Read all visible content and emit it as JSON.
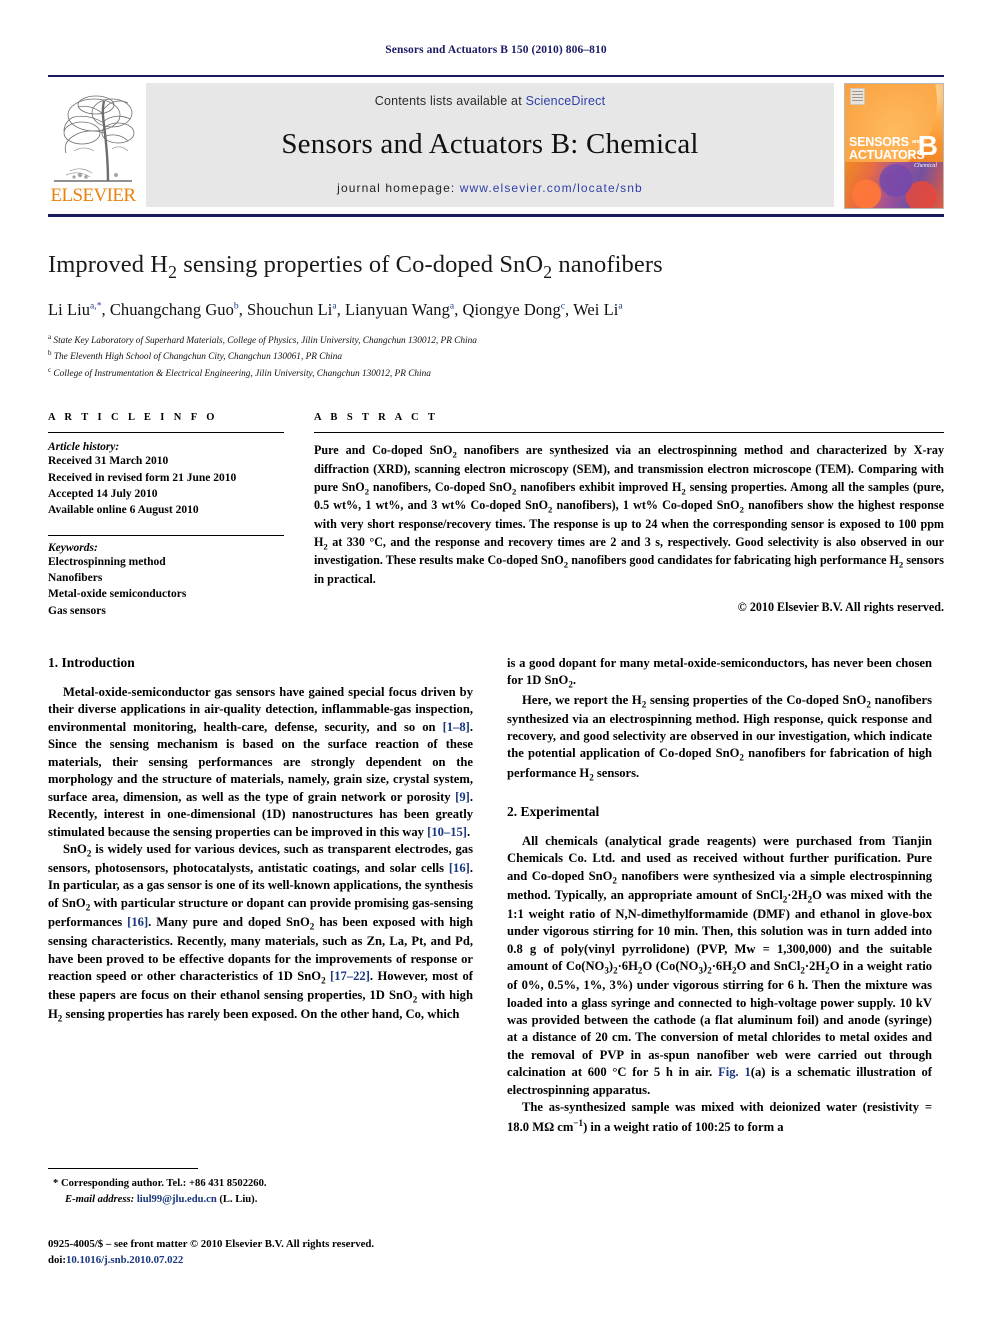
{
  "running_head": "Sensors and Actuators B 150 (2010) 806–810",
  "masthead": {
    "contents_text": "Contents lists available at",
    "sciencedirect_link": "ScienceDirect",
    "journal_title": "Sensors and Actuators B: Chemical",
    "homepage_label": "journal homepage:",
    "homepage_url": "www.elsevier.com/locate/snb",
    "publisher_wordmark": "ELSEVIER",
    "publisher_color": "#e8820c",
    "link_color": "#2f3fa8",
    "rule_color": "#1a1a5e",
    "cover": {
      "line1": "SENSORS",
      "and": "and",
      "line2": "ACTUATORS",
      "letter": "B",
      "subtitle": "Chemical"
    }
  },
  "title_block": {
    "title": "Improved H₂ sensing properties of Co-doped SnO₂ nanofibers",
    "authors": "Li Liu a,*, Chuangchang Guo b, Shouchun Li a, Lianyuan Wang a, Qiongye Dong c, Wei Li a",
    "affiliations": [
      "a State Key Laboratory of Superhard Materials, College of Physics, Jilin University, Changchun 130012, PR China",
      "b The Eleventh High School of Changchun City, Changchun 130061, PR China",
      "c College of Instrumentation & Electrical Engineering, Jilin University, Changchun 130012, PR China"
    ]
  },
  "article_info": {
    "heading": "A R T I C L E   I N F O",
    "history_label": "Article history:",
    "history": [
      "Received 31 March 2010",
      "Received in revised form 21 June 2010",
      "Accepted 14 July 2010",
      "Available online 6 August 2010"
    ],
    "keywords_label": "Keywords:",
    "keywords": [
      "Electrospinning method",
      "Nanofibers",
      "Metal-oxide semiconductors",
      "Gas sensors"
    ]
  },
  "abstract": {
    "heading": "A B S T R A C T",
    "text": "Pure and Co-doped SnO₂ nanofibers are synthesized via an electrospinning method and characterized by X-ray diffraction (XRD), scanning electron microscopy (SEM), and transmission electron microscope (TEM). Comparing with pure SnO₂ nanofibers, Co-doped SnO₂ nanofibers exhibit improved H₂ sensing properties. Among all the samples (pure, 0.5 wt%, 1 wt%, and 3 wt% Co-doped SnO₂ nanofibers), 1 wt% Co-doped SnO₂ nanofibers show the highest response with very short response/recovery times. The response is up to 24 when the corresponding sensor is exposed to 100 ppm H₂ at 330 °C, and the response and recovery times are 2 and 3 s, respectively. Good selectivity is also observed in our investigation. These results make Co-doped SnO₂ nanofibers good candidates for fabricating high performance H₂ sensors in practical.",
    "copyright": "© 2010 Elsevier B.V. All rights reserved."
  },
  "body": {
    "left": {
      "section_title": "1.  Introduction",
      "paragraphs": [
        "Metal-oxide-semiconductor gas sensors have gained special focus driven by their diverse applications in air-quality detection, inflammable-gas inspection, environmental monitoring, health-care, defense, security, and so on [1–8]. Since the sensing mechanism is based on the surface reaction of these materials, their sensing performances are strongly dependent on the morphology and the structure of materials, namely, grain size, crystal system, surface area, dimension, as well as the type of grain network or porosity [9]. Recently, interest in one-dimensional (1D) nanostructures has been greatly stimulated because the sensing properties can be improved in this way [10–15].",
        "SnO₂ is widely used for various devices, such as transparent electrodes, gas sensors, photosensors, photocatalysts, antistatic coatings, and solar cells [16]. In particular, as a gas sensor is one of its well-known applications, the synthesis of SnO₂ with particular structure or dopant can provide promising gas-sensing performances [16]. Many pure and doped SnO₂ has been exposed with high sensing characteristics. Recently, many materials, such as Zn, La, Pt, and Pd, have been proved to be effective dopants for the improvements of response or reaction speed or other characteristics of 1D SnO₂ [17–22]. However, most of these papers are focus on their ethanol sensing properties, 1D SnO₂ with high H₂ sensing properties has rarely been exposed. On the other hand, Co, which"
      ]
    },
    "right": {
      "paragraphs": [
        "is a good dopant for many metal-oxide-semiconductors, has never been chosen for 1D SnO₂.",
        "Here, we report the H₂ sensing properties of the Co-doped SnO₂ nanofibers synthesized via an electrospinning method. High response, quick response and recovery, and good selectivity are observed in our investigation, which indicate the potential application of Co-doped SnO₂ nanofibers for fabrication of high performance H₂ sensors."
      ],
      "section_title": "2.  Experimental",
      "paragraphs2": [
        "All chemicals (analytical grade reagents) were purchased from Tianjin Chemicals Co. Ltd. and used as received without further purification. Pure and Co-doped SnO₂ nanofibers were synthesized via a simple electrospinning method. Typically, an appropriate amount of SnCl₂·2H₂O was mixed with the 1:1 weight ratio of N,N-dimethylformamide (DMF) and ethanol in glove-box under vigorous stirring for 10 min. Then, this solution was in turn added into 0.8 g of poly(vinyl pyrrolidone) (PVP, Mw = 1,300,000) and the suitable amount of Co(NO₃)₂·6H₂O (Co(NO₃)₂·6H₂O and SnCl₂·2H₂O in a weight ratio of 0%, 0.5%, 1%, 3%) under vigorous stirring for 6 h. Then the mixture was loaded into a glass syringe and connected to high-voltage power supply. 10 kV was provided between the cathode (a flat aluminum foil) and anode (syringe) at a distance of 20 cm. The conversion of metal chlorides to metal oxides and the removal of PVP in as-spun nanofiber web were carried out through calcination at 600 °C for 5 h in air. Fig. 1(a) is a schematic illustration of electrospinning apparatus.",
        "The as-synthesized sample was mixed with deionized water (resistivity = 18.0 MΩ cm⁻¹) in a weight ratio of 100:25 to form a"
      ]
    }
  },
  "footnote": {
    "corresponding": "* Corresponding author. Tel.: +86 431 8502260.",
    "email_label": "E-mail address:",
    "email": "liul99@jlu.edu.cn",
    "email_suffix": "(L. Liu).",
    "imprint_line1": "0925-4005/$ – see front matter © 2010 Elsevier B.V. All rights reserved.",
    "imprint_doi_label": "doi:",
    "imprint_doi": "10.1016/j.snb.2010.07.022"
  }
}
